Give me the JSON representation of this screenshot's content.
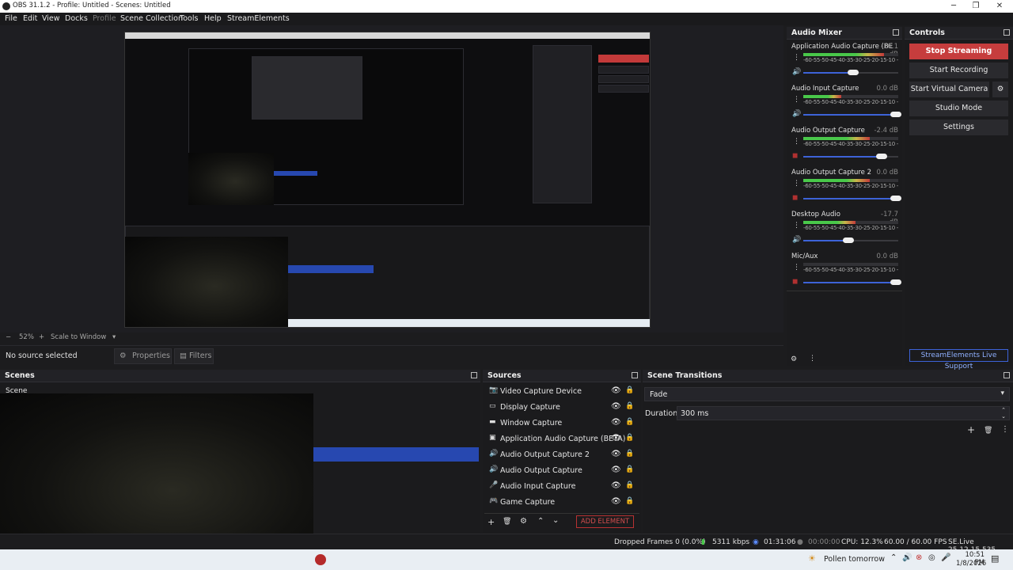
{
  "window": {
    "title": "OBS 31.1.2 - Profile: Untitled - Scenes: Untitled",
    "minimize": "─",
    "maximize": "❐",
    "close": "✕"
  },
  "menu": [
    "File",
    "Edit",
    "View",
    "Docks",
    "Profile",
    "Scene Collection",
    "Tools",
    "Help",
    "StreamElements"
  ],
  "zoom": {
    "minus": "−",
    "level": "52%",
    "plus": "+",
    "mode": "Scale to Window",
    "arrow": "▾"
  },
  "sourcebar": {
    "status": "No source selected",
    "properties": "Properties",
    "filters": "Filters"
  },
  "audio_mixer": {
    "title": "Audio Mixer",
    "ticks": "-60-55-50-45-40-35-30-25-20-15-10 -5 0",
    "channels": [
      {
        "name": "Application Audio Capture (BE",
        "db": "-16.1 dB",
        "level": 0.85,
        "volume": 0.55,
        "muted": false
      },
      {
        "name": "Audio Input Capture",
        "db": "0.0 dB",
        "level": 0.4,
        "volume": 1.0,
        "muted": false
      },
      {
        "name": "Audio Output Capture",
        "db": "-2.4 dB",
        "level": 0.7,
        "volume": 0.85,
        "muted": true
      },
      {
        "name": "Audio Output Capture 2",
        "db": "0.0 dB",
        "level": 0.7,
        "volume": 1.0,
        "muted": true
      },
      {
        "name": "Desktop Audio",
        "db": "-17.7 dB",
        "level": 0.55,
        "volume": 0.5,
        "muted": false
      },
      {
        "name": "Mic/Aux",
        "db": "0.0 dB",
        "level": 0.0,
        "volume": 1.0,
        "muted": true
      }
    ]
  },
  "controls": {
    "title": "Controls",
    "stop_streaming": "Stop Streaming",
    "start_recording": "Start Recording",
    "start_virtual_camera": "Start Virtual Camera",
    "studio_mode": "Studio Mode",
    "settings": "Settings",
    "support": "StreamElements Live Support"
  },
  "scenes": {
    "title": "Scenes",
    "items": [
      "Scene"
    ]
  },
  "sources": {
    "title": "Sources",
    "items": [
      {
        "label": "Video Capture Device",
        "icon": "camera-icon"
      },
      {
        "label": "Display Capture",
        "icon": "monitor-icon"
      },
      {
        "label": "Window Capture",
        "icon": "window-icon"
      },
      {
        "label": "Application Audio Capture (BETA)",
        "icon": "app-audio-icon"
      },
      {
        "label": "Audio Output Capture 2",
        "icon": "speaker-icon"
      },
      {
        "label": "Audio Output Capture",
        "icon": "speaker-icon"
      },
      {
        "label": "Audio Input Capture",
        "icon": "mic-icon"
      },
      {
        "label": "Game Capture",
        "icon": "gamepad-icon"
      }
    ],
    "add_element": "ADD ELEMENT"
  },
  "scene_transitions": {
    "title": "Scene Transitions",
    "transition": "Fade",
    "duration_label": "Duration",
    "duration_value": "300 ms"
  },
  "status": {
    "dropped": "Dropped Frames 0 (0.0%)",
    "bitrate": "5311 kbps",
    "stream_time": "01:31:06",
    "rec_time": "00:00:00",
    "cpu": "CPU: 12.3%",
    "fps": "60.00 / 60.00 FPS",
    "version": "SE.Live 25.12.15.535"
  },
  "taskbar": {
    "weather": "Pollen tomorrow",
    "time": "10:51 PM",
    "date": "1/8/2026"
  },
  "colors": {
    "accent": "#3d63d8",
    "stop": "#c63d3d",
    "meter_green": "#49c84a",
    "meter_yellow": "#c8b64a",
    "meter_red": "#c33a3a"
  }
}
